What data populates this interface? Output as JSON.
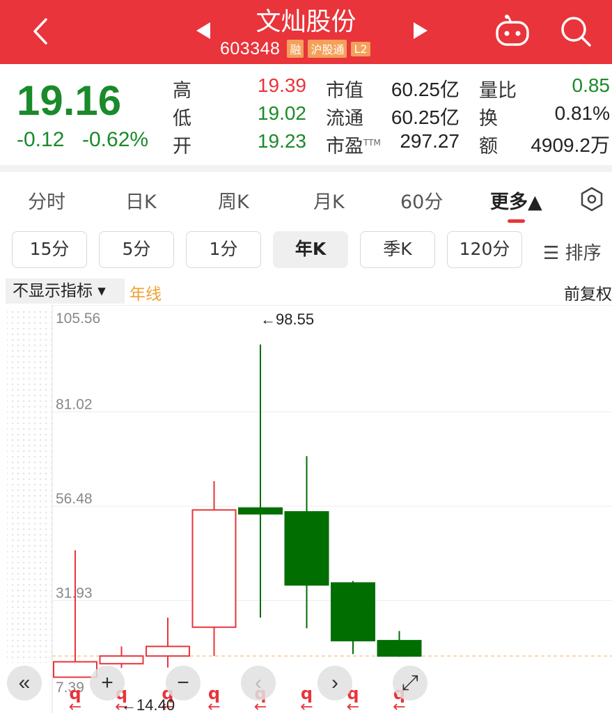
{
  "header": {
    "title": "文灿股份",
    "code": "603348",
    "tags": [
      "融",
      "沪股通",
      "L2"
    ]
  },
  "quote": {
    "price": "19.16",
    "change": "-0.12",
    "change_pct": "-0.62%",
    "high_label": "高",
    "high": "19.39",
    "low_label": "低",
    "low": "19.02",
    "open_label": "开",
    "open": "19.23",
    "mktcap_label": "市值",
    "mktcap": "60.25亿",
    "float_label": "流通",
    "float": "60.25亿",
    "pe_label": "市盈",
    "pe_sup": "TTM",
    "pe": "297.27",
    "vol_ratio_label": "量比",
    "vol_ratio": "0.85",
    "turnover_label": "换",
    "turnover": "0.81%",
    "amount_label": "额",
    "amount": "4909.2万"
  },
  "tabs": [
    "分时",
    "日K",
    "周K",
    "月K",
    "60分",
    "更多▲"
  ],
  "active_tab": "更多▲",
  "periods": [
    "15分",
    "5分",
    "1分",
    "年K",
    "季K",
    "120分"
  ],
  "active_period": "年K",
  "sort_label": "☰ 排序",
  "indicator_label": "不显示指标 ▾",
  "yearline_label": "年线",
  "adjust_label": "前复权",
  "controls": [
    "«",
    "+",
    "−",
    "‹",
    "›",
    "⤢"
  ],
  "colors": {
    "up": "#e8343a",
    "down": "#006e00",
    "brand": "#e8343a",
    "yearline": "#f0a030"
  },
  "chart_data": {
    "type": "candlestick",
    "y_ticks": [
      "105.56",
      "81.02",
      "56.48",
      "31.93",
      "7.39"
    ],
    "ylim": [
      7.39,
      105.56
    ],
    "candles": [
      {
        "open": 12.0,
        "close": 16.0,
        "high": 45.0,
        "low": 12.0,
        "dir": "up"
      },
      {
        "open": 15.5,
        "close": 17.5,
        "high": 20.0,
        "low": 14.4,
        "dir": "up"
      },
      {
        "open": 17.5,
        "close": 20.0,
        "high": 27.5,
        "low": 14.5,
        "dir": "up"
      },
      {
        "open": 25.0,
        "close": 55.5,
        "high": 63.0,
        "low": 17.5,
        "dir": "up"
      },
      {
        "open": 56.0,
        "close": 54.5,
        "high": 98.55,
        "low": 27.5,
        "dir": "down"
      },
      {
        "open": 55.0,
        "close": 36.0,
        "high": 69.5,
        "low": 24.7,
        "dir": "down"
      },
      {
        "open": 36.5,
        "close": 21.5,
        "high": 37.0,
        "low": 18.0,
        "dir": "down"
      },
      {
        "open": 21.5,
        "close": 17.5,
        "high": 24.0,
        "low": 17.3,
        "dir": "down"
      }
    ],
    "max_label": "←98.55",
    "min_label": "←14.40",
    "marker_symbol": "q",
    "marker_arrow": "←",
    "last_price": 17.5
  }
}
